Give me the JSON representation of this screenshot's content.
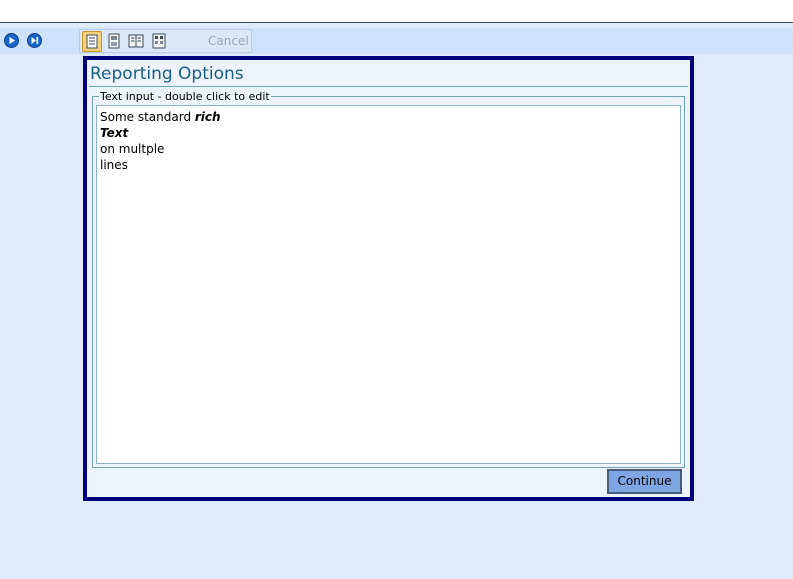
{
  "toolbar": {
    "nav_buttons": [
      "play-icon",
      "skip-icon"
    ],
    "tool_buttons": [
      "page-view-icon",
      "document-view-icon",
      "split-view-icon",
      "grid-view-icon"
    ],
    "cancel_label": "Cancel"
  },
  "dialog": {
    "title": "Reporting Options",
    "group_label": "Text input - double click to edit",
    "text_lines": {
      "l1_plain": "Some standard ",
      "l1_bold": "rich",
      "l2_bold": "Text",
      "l3": "on multple",
      "l4": "lines"
    },
    "continue_label": "Continue"
  },
  "colors": {
    "background": "#deebfc",
    "toolbar": "#cfe2fb",
    "dialog_border": "#00007a",
    "title_text": "#1a5e82",
    "continue_button": "#7ea6e3"
  }
}
